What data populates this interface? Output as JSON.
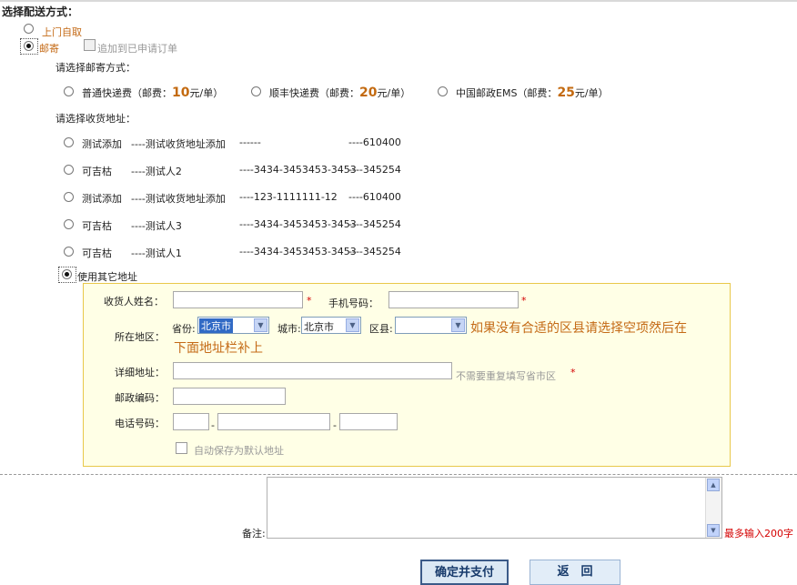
{
  "section_title": "选择配送方式：",
  "delivery": {
    "pickup_label": "上门自取",
    "mail_label": "邮寄",
    "append_label": "追加到已申请订单"
  },
  "shipping": {
    "prompt": "请选择邮寄方式：",
    "options": [
      {
        "name": "普通快递费（邮费：",
        "price": "10",
        "unit": "元/单）"
      },
      {
        "name": "顺丰快递费（邮费：",
        "price": "20",
        "unit": "元/单）"
      },
      {
        "name": "中国邮政EMS（邮费：",
        "price": "25",
        "unit": "元/单）"
      }
    ]
  },
  "address": {
    "prompt": "请选择收货地址：",
    "rows": [
      {
        "name": "测试添加",
        "recipient": "----测试收货地址添加",
        "phone": "------",
        "zip": "----610400"
      },
      {
        "name": "可吉枯",
        "recipient": "----测试人2",
        "phone": "----3434-3453453-3453",
        "zip": "----345254"
      },
      {
        "name": "测试添加",
        "recipient": "----测试收货地址添加",
        "phone": "----123-1111111-12",
        "zip": "----610400"
      },
      {
        "name": "可吉枯",
        "recipient": "----测试人3",
        "phone": "----3434-3453453-3453",
        "zip": "----345254"
      },
      {
        "name": "可吉枯",
        "recipient": "----测试人1",
        "phone": "----3434-3453453-3453",
        "zip": "----345254"
      }
    ],
    "other_label": "使用其它地址"
  },
  "form": {
    "name_label": "收货人姓名：",
    "mobile_label": "手机号码：",
    "required_mark": "*",
    "region_label": "所在地区：",
    "province_label": "省份:",
    "province_value": "北京市",
    "city_label": "城市:",
    "city_value": "北京市",
    "county_label": "区县:",
    "county_value": "",
    "county_hint_line1": "如果没有合适的区县请选择空项然后在",
    "county_hint_line2": "下面地址栏补上",
    "detail_label": "详细地址：",
    "detail_hint": "不需要重复填写省市区",
    "zip_label": "邮政编码：",
    "phone_label": "电话号码：",
    "phone_sep": "-",
    "save_default_label": "自动保存为默认地址"
  },
  "remark": {
    "label": "备注:",
    "limit_text": "最多输入200字"
  },
  "buttons": {
    "confirm": "确定并支付",
    "back": "返　回"
  },
  "colors": {
    "accent_orange": "#c46a16",
    "required_red": "#d40000",
    "form_bg": "#ffffe6",
    "form_border": "#e8c84a"
  }
}
